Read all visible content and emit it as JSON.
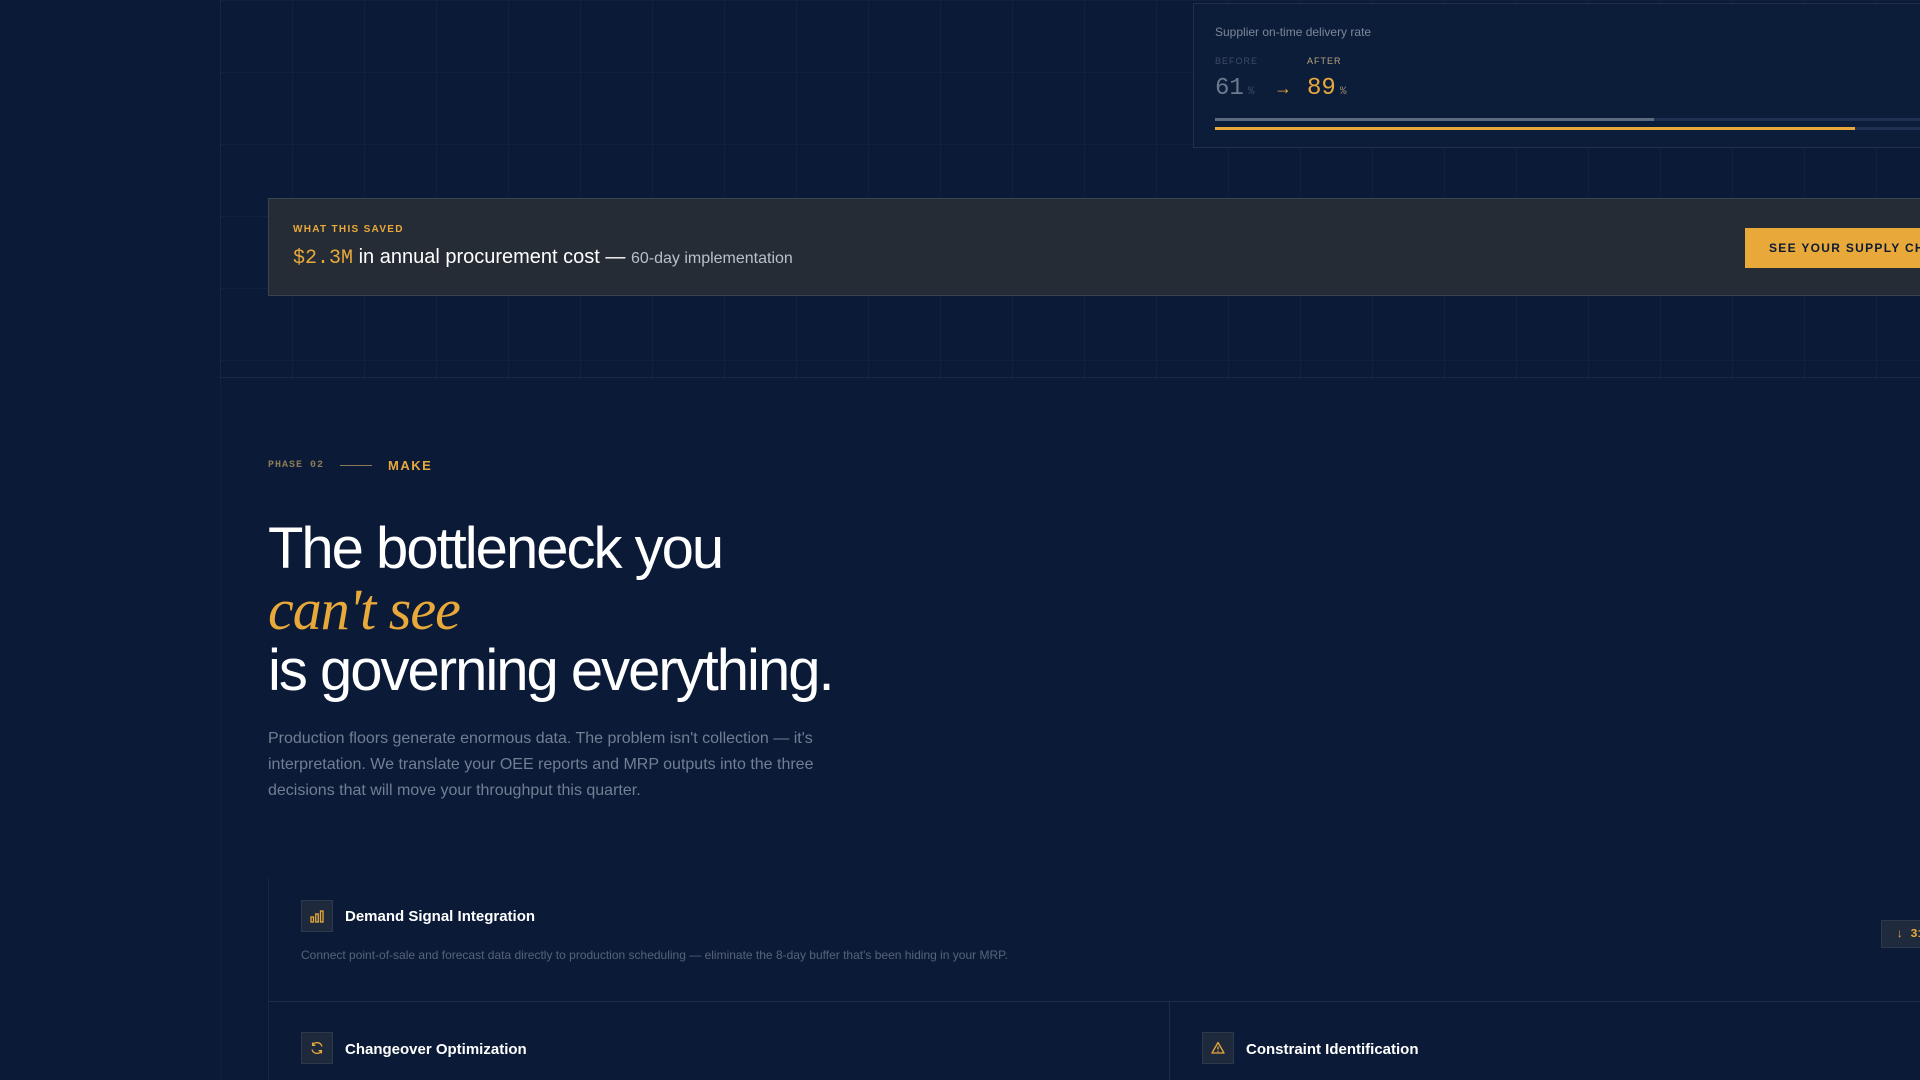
{
  "metric": {
    "title": "Supplier on-time delivery rate",
    "before_label": "BEFORE",
    "after_label": "AFTER",
    "before_value": "61",
    "after_value": "89",
    "unit": "%",
    "arrow": "→",
    "before_fraction": 0.61,
    "after_fraction": 0.89
  },
  "savings": {
    "eyebrow": "WHAT THIS SAVED",
    "amount": "$2.3M",
    "text": "in annual procurement cost —",
    "sub": "60-day implementation",
    "cta_label": "SEE YOUR SUPPLY CH"
  },
  "phase": {
    "number": "PHASE 02",
    "name": "MAKE"
  },
  "headline": {
    "line1": "The bottleneck you",
    "accent": "can't see",
    "line3": "is governing everything."
  },
  "body": "Production floors generate enormous data. The problem isn't collection — it's interpretation. We translate your OEE reports and MRP outputs into the three decisions that will move your throughput this quarter.",
  "features": [
    {
      "icon": "bar-chart-icon",
      "title": "Demand Signal Integration",
      "description": "Connect point-of-sale and forecast data directly to production scheduling — eliminate the 8-day buffer that's been hiding in your MRP.",
      "badge": "↓ 31"
    },
    {
      "icon": "refresh-icon",
      "title": "Changeover Optimization"
    },
    {
      "icon": "warning-icon",
      "title": "Constraint Identification"
    }
  ],
  "colors": {
    "background": "#0b1b37",
    "accent": "#e8a93a",
    "banner": "#262c35"
  }
}
